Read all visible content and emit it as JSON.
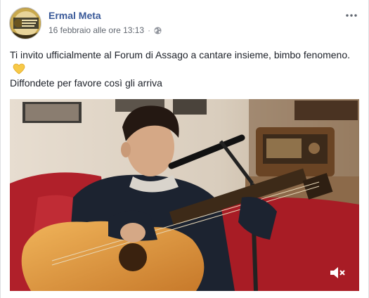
{
  "post": {
    "author": "Ermal Meta",
    "timestamp": "16 febbraio alle ore 13:13",
    "separator": "·",
    "privacy_icon": "globe-icon",
    "more_icon": "more-options-icon",
    "text_line1": "Ti invito ufficialmente al Forum di Assago a cantare insieme, bimbo fenomeno.",
    "emoji": "yellow-heart-icon",
    "text_line2": "Diffondete per favore così gli arriva"
  },
  "video": {
    "mute_icon": "muted-speaker-icon"
  },
  "colors": {
    "name": "#385898",
    "meta": "#616770",
    "heart": "#f7c948"
  }
}
